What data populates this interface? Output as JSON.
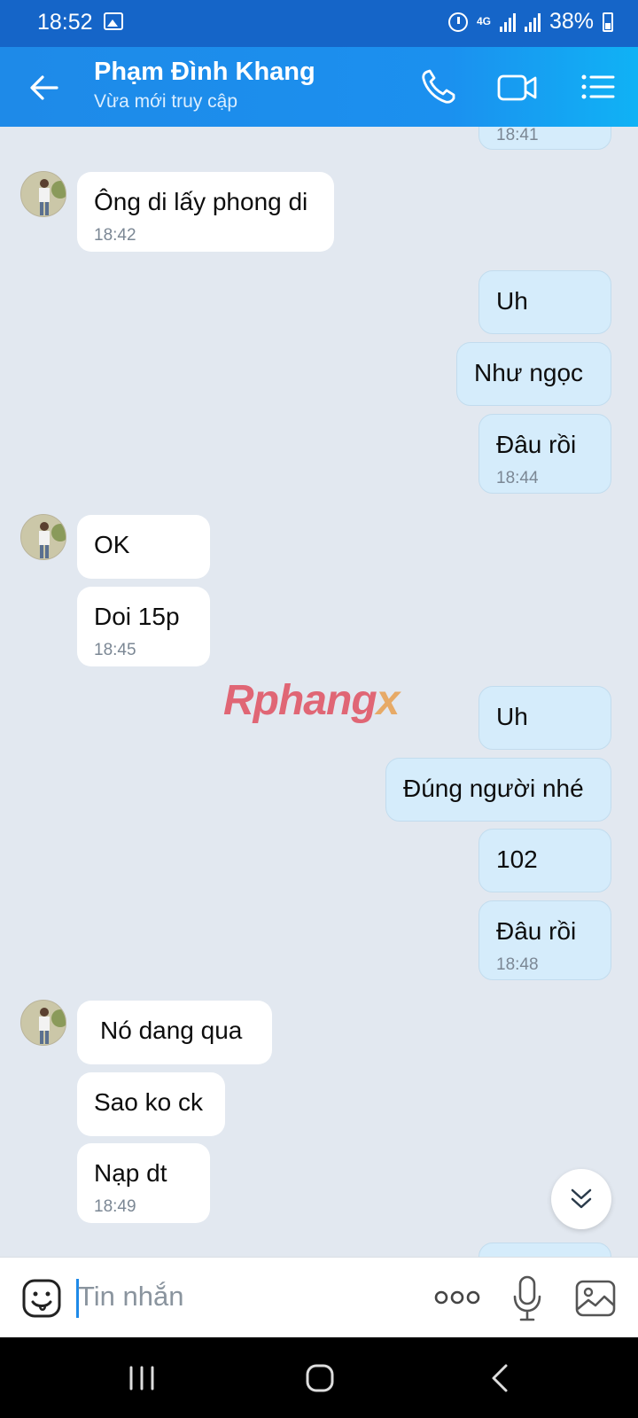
{
  "status_bar": {
    "time": "18:52",
    "network": "4G",
    "battery": "38%"
  },
  "header": {
    "name": "Phạm Đình Khang",
    "status": "Vừa mới truy cập"
  },
  "messages": {
    "m0": {
      "time": "18:41"
    },
    "m1": {
      "text": "Ông di lấy phong di",
      "time": "18:42"
    },
    "m2": {
      "text": "Uh"
    },
    "m3": {
      "text": "Như ngọc"
    },
    "m4": {
      "text": "Đâu rồi",
      "time": "18:44"
    },
    "m5": {
      "text": "OK"
    },
    "m6": {
      "text": "Doi 15p",
      "time": "18:45"
    },
    "m7": {
      "text": "Uh"
    },
    "m8": {
      "text": "Đúng người nhé"
    },
    "m9": {
      "text": "102"
    },
    "m10": {
      "text": "Đâu rồi",
      "time": "18:48"
    },
    "m11": {
      "text": "Nó dang qua"
    },
    "m12": {
      "text": "Sao ko ck"
    },
    "m13": {
      "text": "Nạp dt",
      "time": "18:49"
    }
  },
  "watermark": {
    "a": "Rphang",
    "b": "x"
  },
  "input": {
    "placeholder": "Tin nhắn"
  },
  "colors": {
    "accent": "#1e8ae8",
    "incoming": "#ffffff",
    "outgoing": "#d5ecfb",
    "background": "#e2e8f0"
  },
  "icons": [
    "back-arrow-icon",
    "phone-icon",
    "video-camera-icon",
    "list-icon",
    "sticker-icon",
    "more-dots-icon",
    "microphone-icon",
    "gallery-icon",
    "chevron-double-down-icon"
  ]
}
